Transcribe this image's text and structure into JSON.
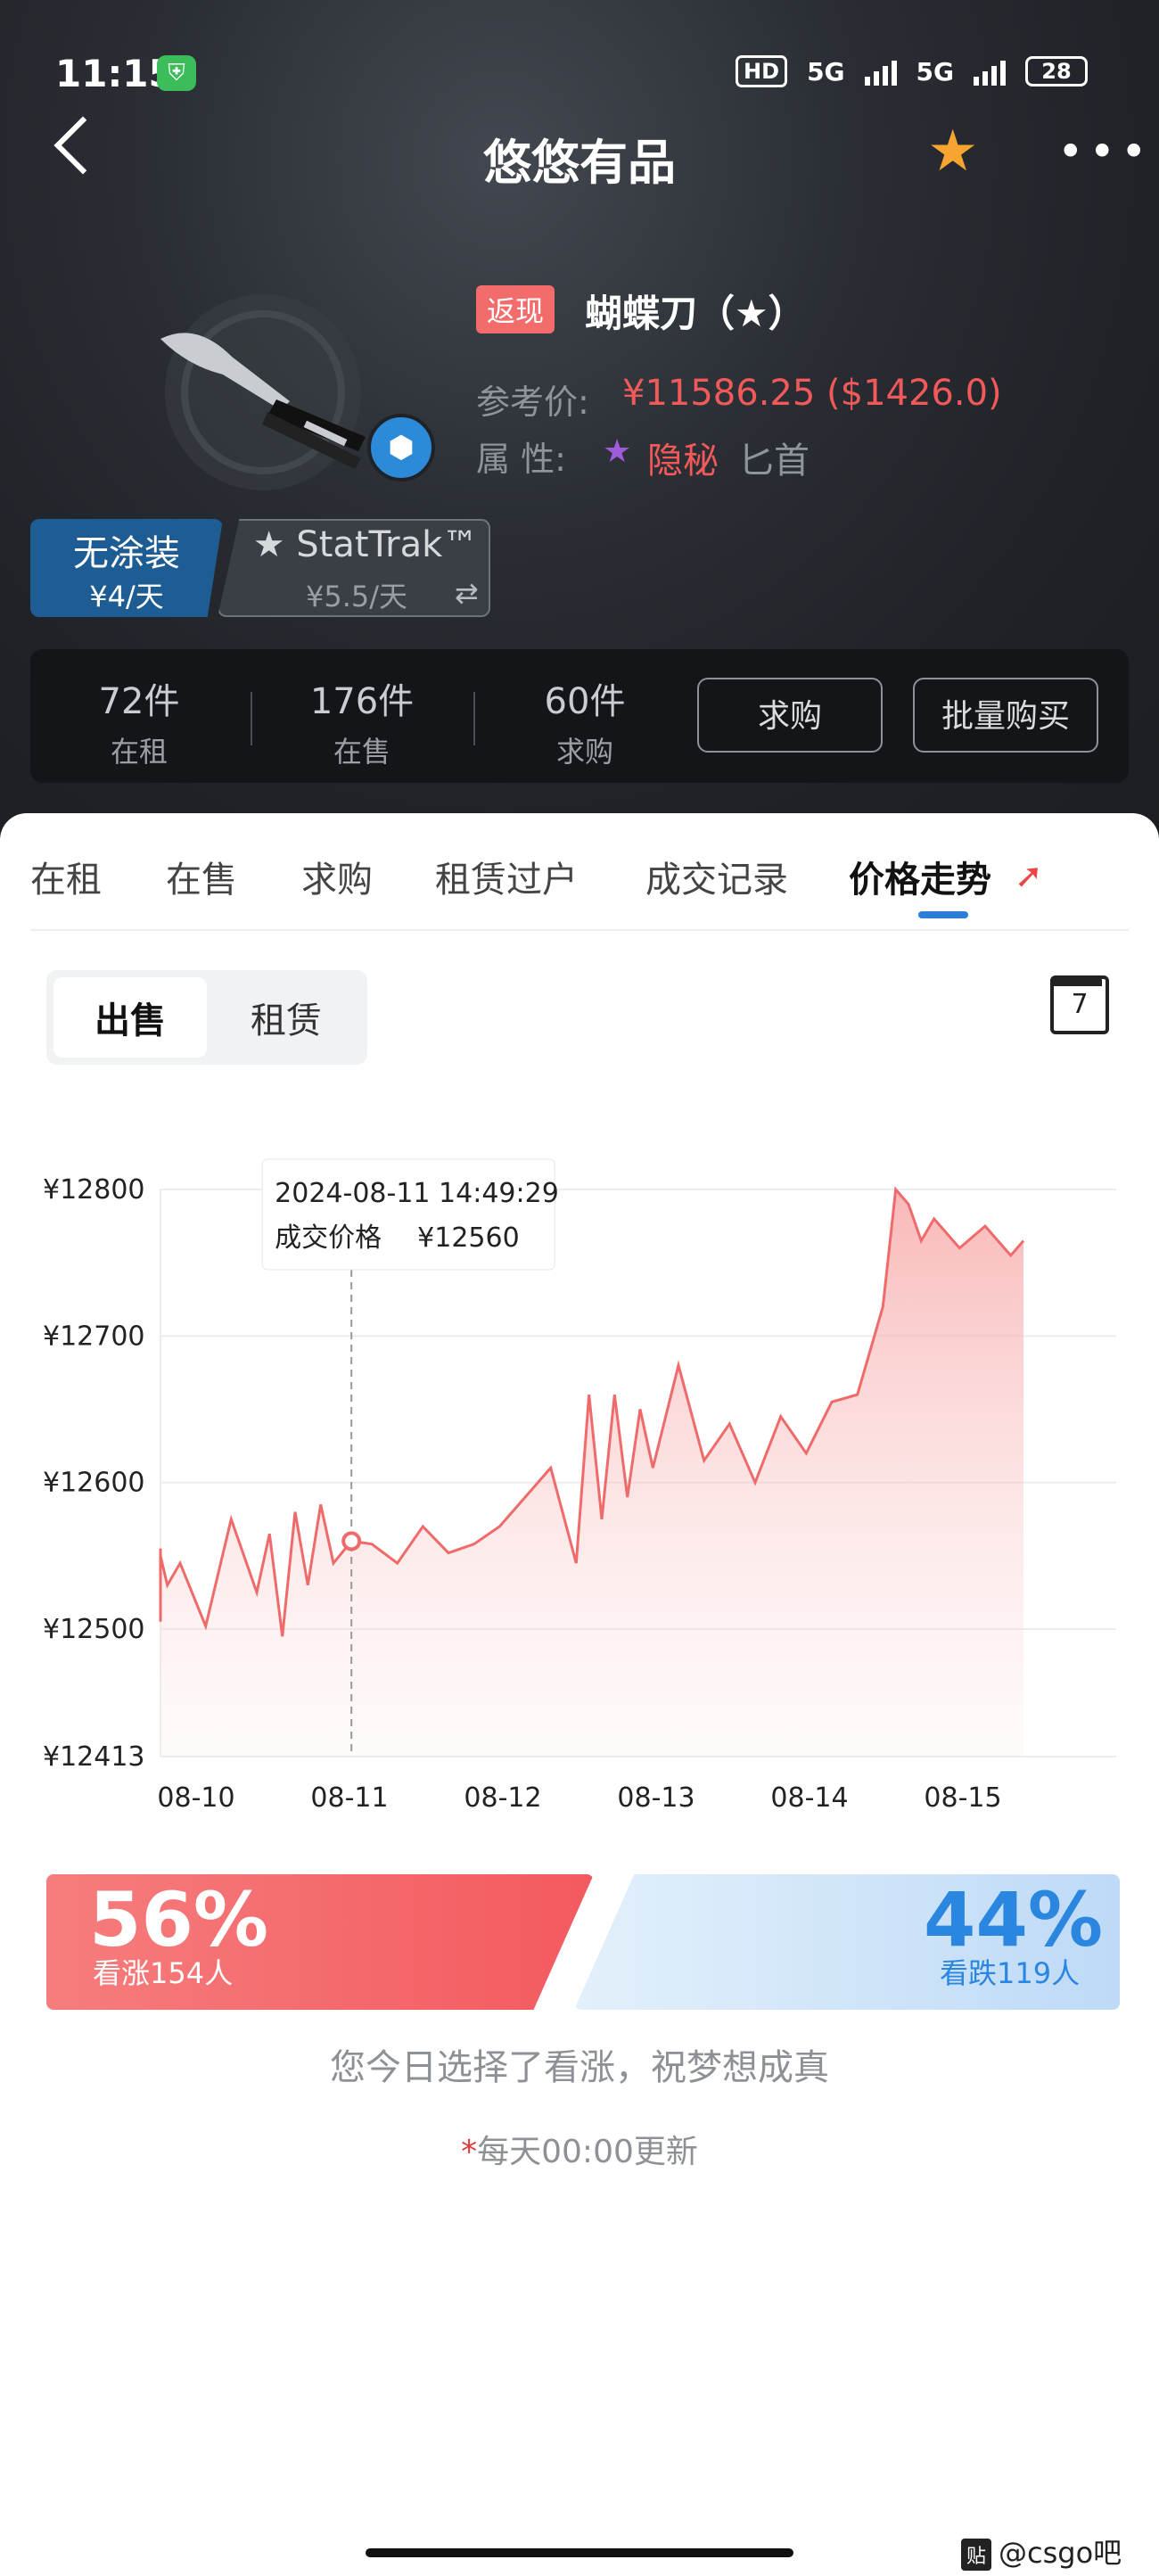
{
  "status_bar": {
    "time": "11:15",
    "hd": "HD",
    "net1": "5G",
    "net2": "5G",
    "battery": "28"
  },
  "header": {
    "title": "悠悠有品"
  },
  "item": {
    "cashback_badge": "返现",
    "name": "蝴蝶刀（★）",
    "ref_price_label": "参考价:",
    "ref_price_value": "¥11586.25 ($1426.0)",
    "attr_label": "属 性:",
    "attr_star": "★",
    "attr_rarity": "隐秘",
    "attr_type": "匕首"
  },
  "variants": [
    {
      "name": "无涂装",
      "price": "¥4/天"
    },
    {
      "name": "★ StatTrak™",
      "price": "¥5.5/天"
    }
  ],
  "stats": [
    {
      "count": "72件",
      "label": "在租"
    },
    {
      "count": "176件",
      "label": "在售"
    },
    {
      "count": "60件",
      "label": "求购"
    }
  ],
  "stat_buttons": {
    "buy_request": "求购",
    "bulk_buy": "批量购买"
  },
  "tabs": [
    "在租",
    "在售",
    "求购",
    "租赁过户",
    "成交记录",
    "价格走势"
  ],
  "segment": {
    "sell": "出售",
    "rent": "租赁"
  },
  "calendar_day": "7",
  "chart_data": {
    "type": "line",
    "title": "",
    "xlabel": "",
    "ylabel": "",
    "ylim": [
      12413,
      12800
    ],
    "y_ticks": [
      "¥12800",
      "¥12700",
      "¥12600",
      "¥12500",
      "¥12413"
    ],
    "x_ticks": [
      "08-10",
      "08-11",
      "08-12",
      "08-13",
      "08-14",
      "08-15"
    ],
    "line_color": "#ef6a6a",
    "tooltip": {
      "date": "2024-08-11 14:49:29",
      "label": "成交价格",
      "value": "¥12560"
    },
    "series": [
      {
        "x": [
          "08-10 00:00",
          "08-10 04:00",
          "08-10 06:00",
          "08-10 08:00",
          "08-10 10:00",
          "08-10 12:00",
          "08-10 16:00",
          "08-10 20:00",
          "08-11 00:00",
          "08-11 02:00",
          "08-11 04:00",
          "08-11 06:00",
          "08-11 08:00",
          "08-11 10:00",
          "08-11 12:00",
          "08-11 14:49",
          "08-11 18:00",
          "08-11 22:00",
          "08-12 02:00",
          "08-12 06:00",
          "08-12 10:00",
          "08-12 14:00",
          "08-12 18:00",
          "08-12 22:00",
          "08-13 02:00",
          "08-13 04:00",
          "08-13 06:00",
          "08-13 08:00",
          "08-13 10:00",
          "08-13 12:00",
          "08-13 14:00",
          "08-13 18:00",
          "08-13 22:00",
          "08-14 02:00",
          "08-14 06:00",
          "08-14 10:00",
          "08-14 14:00",
          "08-14 18:00",
          "08-14 22:00",
          "08-15 02:00",
          "08-15 04:00",
          "08-15 06:00",
          "08-15 08:00",
          "08-15 10:00",
          "08-15 14:00",
          "08-15 18:00",
          "08-15 22:00",
          "08-16 00:00"
        ],
        "y": [
          12520,
          12555,
          12505,
          12550,
          12530,
          12545,
          12502,
          12575,
          12525,
          12565,
          12495,
          12580,
          12530,
          12585,
          12545,
          12560,
          12558,
          12545,
          12570,
          12552,
          12558,
          12570,
          12590,
          12610,
          12545,
          12660,
          12575,
          12660,
          12590,
          12650,
          12610,
          12680,
          12615,
          12640,
          12600,
          12645,
          12620,
          12655,
          12660,
          12720,
          12800,
          12790,
          12765,
          12780,
          12760,
          12775,
          12755,
          12765
        ]
      }
    ]
  },
  "vote": {
    "up_pct": "56%",
    "up_people": "看涨154人",
    "down_pct": "44%",
    "down_people": "看跌119人",
    "message": "您今日选择了看涨，祝梦想成真"
  },
  "update_note": {
    "asterisk": "*",
    "text": "每天00:00更新"
  },
  "watermark": {
    "badge": "贴",
    "text": "@csgo吧"
  }
}
